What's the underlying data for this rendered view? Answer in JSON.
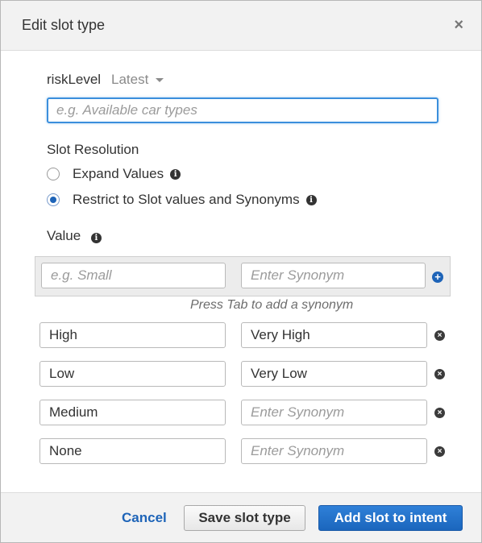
{
  "dialog": {
    "title": "Edit slot type",
    "close_glyph": "×"
  },
  "slot": {
    "name": "riskLevel",
    "version": "Latest",
    "description_placeholder": "e.g. Available car types",
    "description_value": ""
  },
  "resolution": {
    "label": "Slot Resolution",
    "options": [
      {
        "label": "Expand Values",
        "selected": false
      },
      {
        "label": "Restrict to Slot values and Synonyms",
        "selected": true
      }
    ]
  },
  "values_section": {
    "label": "Value",
    "new_value_placeholder": "e.g. Small",
    "new_synonym_placeholder": "Enter Synonym",
    "hint": "Press Tab to add a synonym",
    "rows": [
      {
        "value": "High",
        "synonym": "Very High"
      },
      {
        "value": "Low",
        "synonym": "Very Low"
      },
      {
        "value": "Medium",
        "synonym": ""
      },
      {
        "value": "None",
        "synonym": ""
      }
    ],
    "synonym_placeholder": "Enter Synonym"
  },
  "footer": {
    "cancel_label": "Cancel",
    "save_label": "Save slot type",
    "add_label": "Add slot to intent"
  },
  "colors": {
    "accent": "#1e64b8",
    "focus_border": "#3b8fdc"
  },
  "icons": {
    "info": "info-icon",
    "add": "plus-circle-icon",
    "remove": "remove-circle-icon",
    "close": "close-icon"
  }
}
